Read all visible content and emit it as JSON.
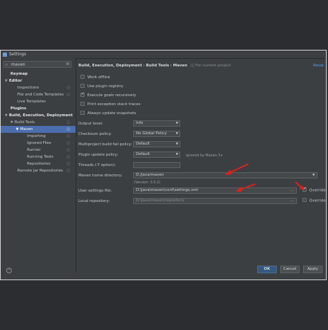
{
  "window": {
    "title": "Settings"
  },
  "search": {
    "query": "maven"
  },
  "sidebar": {
    "items": [
      {
        "label": "Keymap",
        "bold": true
      },
      {
        "label": "Editor",
        "bold": true,
        "arrow": "▼"
      },
      {
        "label": "Inspections"
      },
      {
        "label": "File and Code Templates"
      },
      {
        "label": "Live Templates"
      },
      {
        "label": "Plugins",
        "bold": true
      },
      {
        "label": "Build, Execution, Deployment",
        "bold": true,
        "arrow": "▼"
      },
      {
        "label": "Build Tools",
        "arrow": "▼"
      },
      {
        "label": "Maven",
        "arrow": "▼",
        "selected": true
      },
      {
        "label": "Importing"
      },
      {
        "label": "Ignored Files"
      },
      {
        "label": "Runner"
      },
      {
        "label": "Running Tests"
      },
      {
        "label": "Repositories"
      },
      {
        "label": "Remote Jar Repositories"
      }
    ]
  },
  "breadcrumb": {
    "part1": "Build, Execution, Deployment",
    "sep": "›",
    "part2": "Build Tools",
    "part3": "Maven",
    "note": "For current project"
  },
  "reset_label": "Reset",
  "checkboxes": [
    {
      "label": "Work offline",
      "checked": false
    },
    {
      "label": "Use plugin registry",
      "checked": false
    },
    {
      "label": "Execute goals recursively",
      "checked": true
    },
    {
      "label": "Print exception stack traces",
      "checked": false
    },
    {
      "label": "Always update snapshots",
      "checked": false
    }
  ],
  "form": {
    "output_level": {
      "label": "Output level:",
      "value": "Info"
    },
    "checksum_policy": {
      "label": "Checksum policy:",
      "value": "No Global Policy"
    },
    "fail_policy": {
      "label": "Multiproject build fail policy:",
      "value": "Default"
    },
    "update_policy": {
      "label": "Plugin update policy:",
      "value": "Default",
      "hint": "ignored by Maven 3+"
    },
    "threads": {
      "label": "Threads (-T option):",
      "value": ""
    },
    "maven_home": {
      "label": "Maven home directory:",
      "value": "D:/Java/maven",
      "version": "(Version: 3.5.2)"
    },
    "settings_file": {
      "label": "User settings file:",
      "value": "D:\\Java\\maven\\conf\\settings.xml",
      "override_label": "Override",
      "override": true
    },
    "local_repo": {
      "label": "Local repository:",
      "value": "D:\\Java\\maven\\repository",
      "override_label": "Override",
      "override": false
    }
  },
  "buttons": {
    "ok": "OK",
    "cancel": "Cancel",
    "apply": "Apply"
  },
  "icons": {
    "help": "?"
  },
  "colors": {
    "selection": "#4b6eaf",
    "annotation_arrow": "#e0201c",
    "link": "#589df6"
  }
}
